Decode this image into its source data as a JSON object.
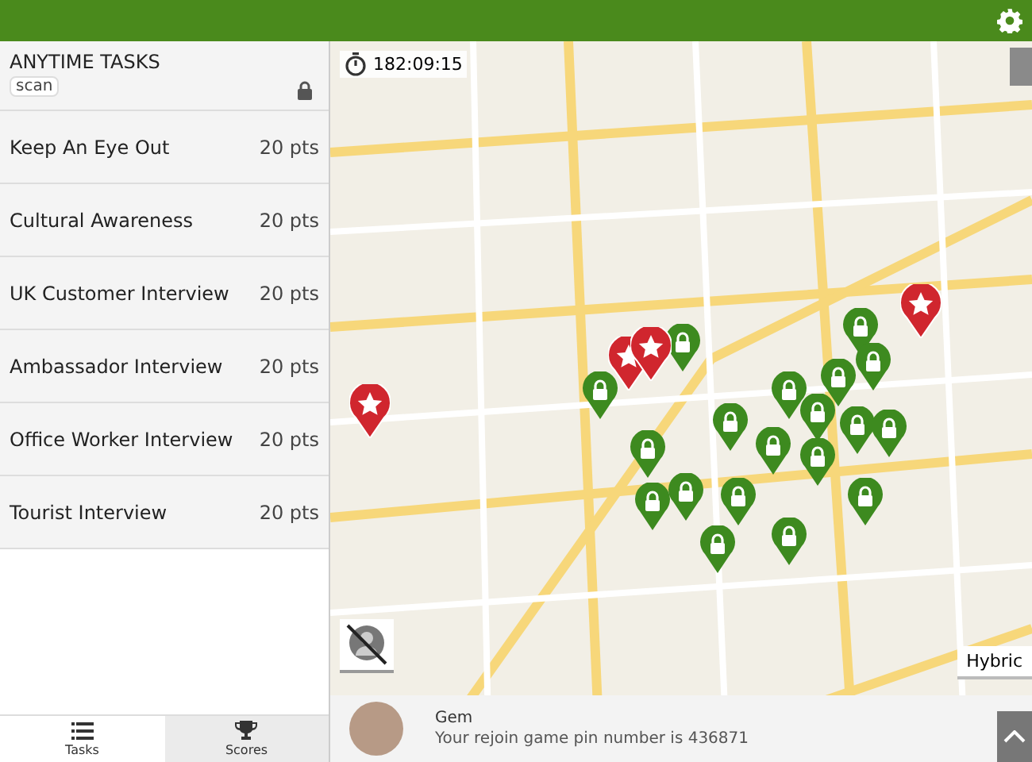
{
  "task_panel": {
    "title": "ANYTIME TASKS",
    "tag": "scan",
    "locked": true
  },
  "tasks": [
    {
      "name": "Keep An Eye Out",
      "points": "20 pts"
    },
    {
      "name": "Cultural Awareness",
      "points": "20 pts"
    },
    {
      "name": "UK Customer Interview",
      "points": "20 pts"
    },
    {
      "name": "Ambassador Interview",
      "points": "20 pts"
    },
    {
      "name": "Office Worker Interview",
      "points": "20 pts"
    },
    {
      "name": "Tourist Interview",
      "points": "20 pts"
    }
  ],
  "tabs": [
    {
      "label": "Tasks",
      "kind": "list",
      "selected": true
    },
    {
      "label": "Scores",
      "kind": "trophy",
      "selected": false
    }
  ],
  "map": {
    "timer": "182:09:15",
    "map_type_button": "Hybric"
  },
  "chat": {
    "sender": "Gem",
    "message": "Your rejoin game pin number is 436871"
  }
}
